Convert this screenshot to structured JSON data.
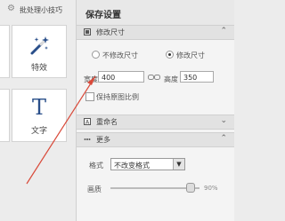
{
  "left": {
    "tip_text": "批处理小技巧",
    "effects_label": "特效",
    "text_label": "文字"
  },
  "panel": {
    "title": "保存设置",
    "resize_section": "修改尺寸",
    "radio_no_resize": "不修改尺寸",
    "radio_resize": "修改尺寸",
    "width_label": "宽度",
    "width_value": "400",
    "height_label": "高度",
    "height_value": "350",
    "keep_ratio_label": "保持原图比例",
    "rename_section": "重命名",
    "more_section": "更多",
    "format_label": "格式",
    "format_value": "不改变格式",
    "quality_label": "画质",
    "quality_value": "90%",
    "quality_fraction": 0.9
  },
  "colors": {
    "arrow": "#d94a3a",
    "accent": "#3a6fb0"
  }
}
